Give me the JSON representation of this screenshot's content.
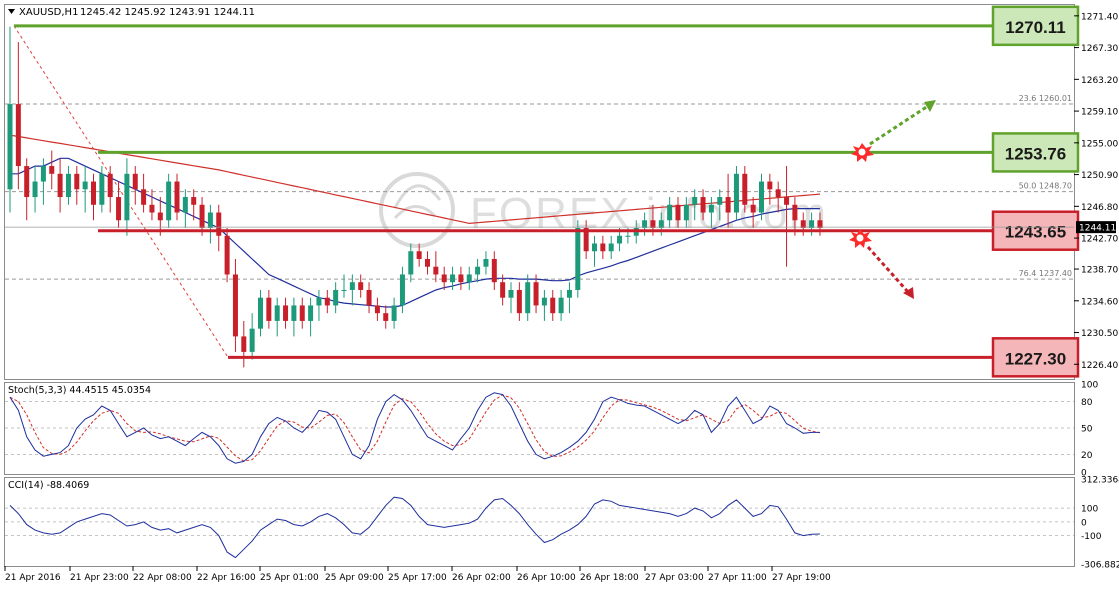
{
  "header": {
    "symbol": "XAUUSD,H1",
    "ohlc": "1245.42 1245.92 1243.91 1244.11"
  },
  "watermark": "FOREX.info.com",
  "price_axis": {
    "ticks": [
      "1271.40",
      "1267.30",
      "1263.20",
      "1259.10",
      "1255.00",
      "1250.90",
      "1246.80",
      "1242.70",
      "1238.70",
      "1234.60",
      "1230.50",
      "1226.40"
    ],
    "tick_values": [
      1271.4,
      1267.3,
      1263.2,
      1259.1,
      1255.0,
      1250.9,
      1246.8,
      1242.7,
      1238.7,
      1234.6,
      1230.5,
      1226.4
    ],
    "current_price": "1244.11",
    "current_value": 1244.11
  },
  "levels": [
    {
      "label": "1270.11",
      "value": 1270.11,
      "color": "#5fa22c",
      "kind": "resistance"
    },
    {
      "label": "1253.76",
      "value": 1253.76,
      "color": "#5fa22c",
      "kind": "resistance"
    },
    {
      "label": "1243.65",
      "value": 1243.65,
      "color": "#c8202a",
      "kind": "support"
    },
    {
      "label": "1227.30",
      "value": 1227.3,
      "color": "#c8202a",
      "kind": "support"
    }
  ],
  "fibo": [
    {
      "label": "23.6  1260.01",
      "value": 1260.01
    },
    {
      "label": "50.0  1248.70",
      "value": 1248.7
    },
    {
      "label": "76.4  1237.40",
      "value": 1237.4
    }
  ],
  "time_axis": [
    "21 Apr 2016",
    "21 Apr 23:00",
    "22 Apr 08:00",
    "22 Apr 16:00",
    "25 Apr 01:00",
    "25 Apr 09:00",
    "25 Apr 17:00",
    "26 Apr 02:00",
    "26 Apr 10:00",
    "26 Apr 18:00",
    "27 Apr 03:00",
    "27 Apr 11:00",
    "27 Apr 19:00"
  ],
  "stoch": {
    "title": "Stoch(5,3,3) 44.4515 45.0354",
    "ticks": [
      "100",
      "80",
      "50",
      "20",
      "0"
    ],
    "tick_values": [
      100,
      80,
      50,
      20,
      0
    ]
  },
  "cci": {
    "title": "CCI(14) -88.4069",
    "ticks": [
      "312.3364",
      "100",
      "0",
      "-100",
      "-306.8829"
    ],
    "tick_values": [
      312.3364,
      100,
      0,
      -100,
      -306.8829
    ]
  },
  "chart_data": {
    "type": "candlestick",
    "title": "XAUUSD,H1",
    "ylim": [
      1224.5,
      1272.8
    ],
    "candles": [
      [
        1249,
        1270,
        1246,
        1260
      ],
      [
        1260,
        1268,
        1249,
        1252
      ],
      [
        1252,
        1253,
        1245,
        1248
      ],
      [
        1248,
        1252,
        1246,
        1250
      ],
      [
        1250,
        1253,
        1247,
        1252
      ],
      [
        1252,
        1254,
        1249,
        1251
      ],
      [
        1251,
        1253,
        1246,
        1248
      ],
      [
        1248,
        1252,
        1247,
        1251
      ],
      [
        1251,
        1252,
        1247,
        1249
      ],
      [
        1249,
        1252,
        1246,
        1250
      ],
      [
        1250,
        1251,
        1245,
        1247
      ],
      [
        1247,
        1252,
        1246,
        1251
      ],
      [
        1251,
        1252,
        1246,
        1248
      ],
      [
        1248,
        1250,
        1244,
        1245
      ],
      [
        1245,
        1253,
        1243,
        1251
      ],
      [
        1251,
        1252,
        1247,
        1249
      ],
      [
        1249,
        1251,
        1246,
        1247
      ],
      [
        1247,
        1249,
        1245,
        1246
      ],
      [
        1246,
        1248,
        1243,
        1245
      ],
      [
        1245,
        1251,
        1244,
        1250
      ],
      [
        1250,
        1251,
        1245,
        1246
      ],
      [
        1246,
        1249,
        1244,
        1248
      ],
      [
        1248,
        1249,
        1245,
        1247
      ],
      [
        1247,
        1248,
        1243,
        1244
      ],
      [
        1244,
        1247,
        1242,
        1246
      ],
      [
        1246,
        1247,
        1241,
        1243
      ],
      [
        1243,
        1244,
        1237,
        1238
      ],
      [
        1238,
        1240,
        1228,
        1230
      ],
      [
        1230,
        1232,
        1226,
        1228
      ],
      [
        1228,
        1233,
        1227,
        1231
      ],
      [
        1231,
        1236,
        1230,
        1235
      ],
      [
        1235,
        1236,
        1231,
        1232
      ],
      [
        1232,
        1235,
        1230,
        1234
      ],
      [
        1234,
        1235,
        1231,
        1232
      ],
      [
        1232,
        1235,
        1230,
        1234
      ],
      [
        1234,
        1235,
        1231,
        1232
      ],
      [
        1232,
        1235,
        1230,
        1234
      ],
      [
        1234,
        1236,
        1232,
        1235
      ],
      [
        1235,
        1236,
        1233,
        1234
      ],
      [
        1234,
        1237,
        1233,
        1236
      ],
      [
        1236,
        1238,
        1235,
        1236
      ],
      [
        1236,
        1238,
        1234,
        1237
      ],
      [
        1237,
        1238,
        1235,
        1236
      ],
      [
        1236,
        1237,
        1233,
        1234
      ],
      [
        1234,
        1235,
        1232,
        1233
      ],
      [
        1233,
        1234,
        1231,
        1232
      ],
      [
        1232,
        1235,
        1231,
        1234
      ],
      [
        1234,
        1239,
        1233,
        1238
      ],
      [
        1238,
        1242,
        1237,
        1241
      ],
      [
        1241,
        1242,
        1239,
        1240
      ],
      [
        1240,
        1241,
        1238,
        1239
      ],
      [
        1239,
        1241,
        1237,
        1238
      ],
      [
        1238,
        1239,
        1236,
        1237
      ],
      [
        1237,
        1239,
        1236,
        1238
      ],
      [
        1238,
        1239,
        1236,
        1237
      ],
      [
        1237,
        1239,
        1236,
        1238
      ],
      [
        1238,
        1240,
        1237,
        1239
      ],
      [
        1239,
        1241,
        1238,
        1240
      ],
      [
        1240,
        1241,
        1236,
        1237
      ],
      [
        1237,
        1238,
        1234,
        1235
      ],
      [
        1235,
        1237,
        1233,
        1236
      ],
      [
        1236,
        1237,
        1232,
        1233
      ],
      [
        1233,
        1238,
        1232,
        1237
      ],
      [
        1237,
        1238,
        1233,
        1234
      ],
      [
        1234,
        1236,
        1232,
        1235
      ],
      [
        1235,
        1236,
        1232,
        1233
      ],
      [
        1233,
        1236,
        1232,
        1235
      ],
      [
        1235,
        1237,
        1233,
        1236
      ],
      [
        1236,
        1245,
        1235,
        1244
      ],
      [
        1244,
        1245,
        1240,
        1241
      ],
      [
        1241,
        1243,
        1239,
        1242
      ],
      [
        1242,
        1243,
        1240,
        1241
      ],
      [
        1241,
        1243,
        1240,
        1242
      ],
      [
        1242,
        1244,
        1241,
        1243
      ],
      [
        1243,
        1244,
        1242,
        1243
      ],
      [
        1243,
        1245,
        1242,
        1244
      ],
      [
        1244,
        1246,
        1243,
        1245
      ],
      [
        1245,
        1247,
        1243,
        1244
      ],
      [
        1244,
        1246,
        1243,
        1245
      ],
      [
        1245,
        1248,
        1244,
        1247
      ],
      [
        1247,
        1248,
        1244,
        1245
      ],
      [
        1245,
        1248,
        1244,
        1247
      ],
      [
        1247,
        1249,
        1245,
        1248
      ],
      [
        1248,
        1249,
        1245,
        1246
      ],
      [
        1246,
        1248,
        1244,
        1247
      ],
      [
        1247,
        1249,
        1245,
        1248
      ],
      [
        1248,
        1251,
        1244,
        1246
      ],
      [
        1246,
        1252,
        1245,
        1251
      ],
      [
        1251,
        1252,
        1246,
        1247
      ],
      [
        1247,
        1248,
        1244,
        1246
      ],
      [
        1246,
        1251,
        1245,
        1250
      ],
      [
        1250,
        1251,
        1247,
        1249
      ],
      [
        1249,
        1250,
        1246,
        1248
      ],
      [
        1248,
        1252,
        1239,
        1247
      ],
      [
        1247,
        1248,
        1243,
        1245
      ],
      [
        1245,
        1246,
        1243,
        1244
      ],
      [
        1244,
        1246,
        1243,
        1245
      ],
      [
        1245,
        1246,
        1243,
        1244
      ]
    ],
    "ma_fast": [
      1251,
      1251,
      1251.5,
      1252,
      1252,
      1252.5,
      1253,
      1253,
      1252.5,
      1252,
      1251.5,
      1251,
      1250.5,
      1250,
      1249.5,
      1249,
      1248.5,
      1248,
      1247.5,
      1247,
      1246.5,
      1246,
      1245.5,
      1245,
      1244.5,
      1244,
      1243,
      1242,
      1241,
      1240,
      1239,
      1238,
      1237.5,
      1237,
      1236.5,
      1236,
      1235.5,
      1235,
      1234.8,
      1234.5,
      1234.3,
      1234.2,
      1234.1,
      1234,
      1233.9,
      1233.8,
      1233.8,
      1234,
      1234.5,
      1235,
      1235.5,
      1236,
      1236.3,
      1236.5,
      1236.8,
      1237,
      1237.2,
      1237.4,
      1237.5,
      1237.5,
      1237.5,
      1237.4,
      1237.4,
      1237.4,
      1237.3,
      1237.2,
      1237.2,
      1237.3,
      1237.8,
      1238.2,
      1238.5,
      1238.8,
      1239.1,
      1239.5,
      1239.8,
      1240.2,
      1240.6,
      1241,
      1241.4,
      1241.8,
      1242.2,
      1242.6,
      1243,
      1243.4,
      1243.8,
      1244.2,
      1244.6,
      1245,
      1245.3,
      1245.5,
      1245.8,
      1246,
      1246.2,
      1246.4,
      1246.5,
      1246.5,
      1246.5,
      1246.5
    ]
  }
}
